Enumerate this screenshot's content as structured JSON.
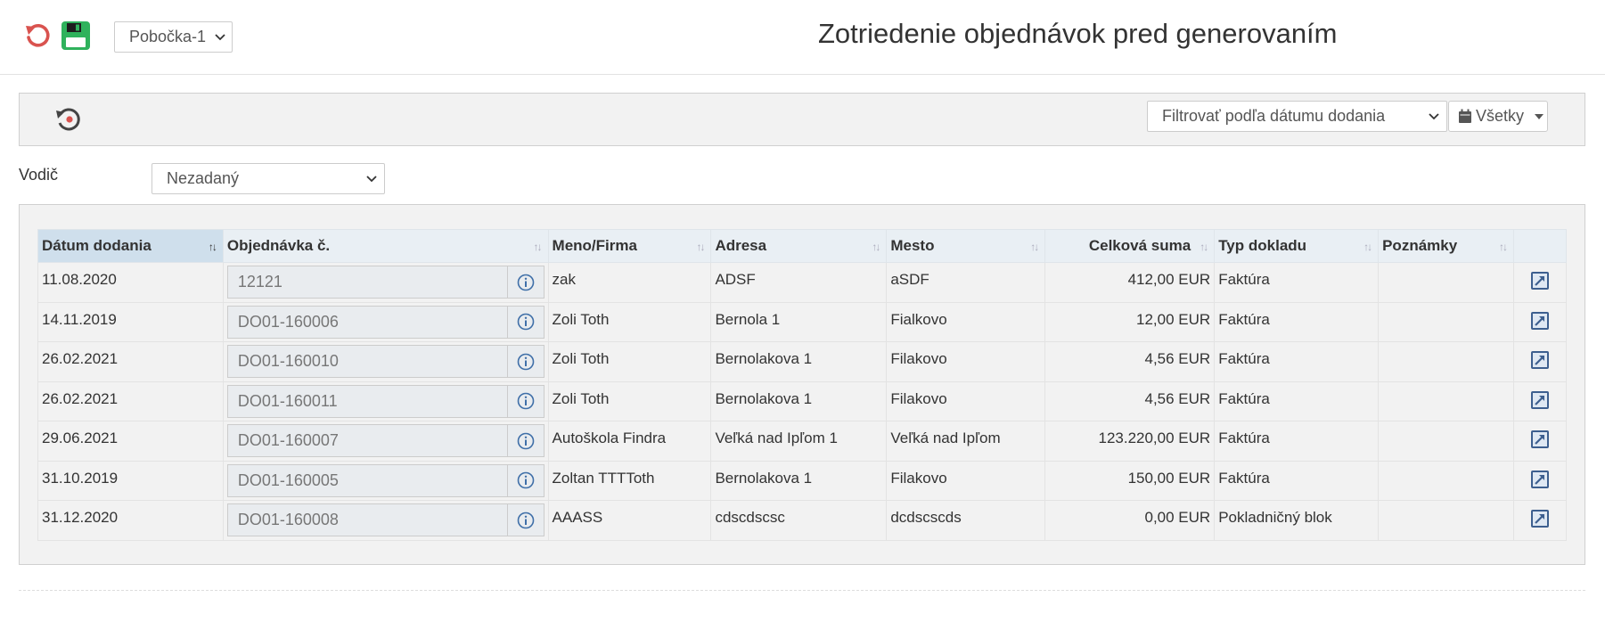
{
  "header": {
    "branch_select": "Pobočka-1",
    "title": "Zotriedenie objednávok pred generovaním"
  },
  "filters": {
    "date_filter_placeholder": "Filtrovať podľa dátumu dodania",
    "all_label": "Všetky",
    "driver_label": "Vodič",
    "driver_value": "Nezadaný"
  },
  "table": {
    "columns": [
      "Dátum dodania",
      "Objednávka č.",
      "Meno/Firma",
      "Adresa",
      "Mesto",
      "Celková suma",
      "Typ dokladu",
      "Poznámky"
    ],
    "rows": [
      {
        "date": "11.08.2020",
        "order": "12121",
        "name": "zak",
        "address": "ADSF",
        "city": "aSDF",
        "total": "412,00 EUR",
        "doc_type": "Faktúra",
        "notes": ""
      },
      {
        "date": "14.11.2019",
        "order": "DO01-160006",
        "name": "Zoli Toth",
        "address": "Bernola 1",
        "city": "Fialkovo",
        "total": "12,00 EUR",
        "doc_type": "Faktúra",
        "notes": ""
      },
      {
        "date": "26.02.2021",
        "order": "DO01-160010",
        "name": "Zoli Toth",
        "address": "Bernolakova 1",
        "city": "Filakovo",
        "total": "4,56 EUR",
        "doc_type": "Faktúra",
        "notes": ""
      },
      {
        "date": "26.02.2021",
        "order": "DO01-160011",
        "name": "Zoli Toth",
        "address": "Bernolakova 1",
        "city": "Filakovo",
        "total": "4,56 EUR",
        "doc_type": "Faktúra",
        "notes": ""
      },
      {
        "date": "29.06.2021",
        "order": "DO01-160007",
        "name": "Autoškola Findra",
        "address": "Veľká nad Ipľom 1",
        "city": "Veľká nad Ipľom",
        "total": "123.220,00 EUR",
        "doc_type": "Faktúra",
        "notes": ""
      },
      {
        "date": "31.10.2019",
        "order": "DO01-160005",
        "name": "Zoltan TTTToth",
        "address": "Bernolakova 1",
        "city": "Filakovo",
        "total": "150,00 EUR",
        "doc_type": "Faktúra",
        "notes": ""
      },
      {
        "date": "31.12.2020",
        "order": "DO01-160008",
        "name": "AAASS",
        "address": "cdscdscsc",
        "city": "dcdscscds",
        "total": "0,00 EUR",
        "doc_type": "Pokladničný blok",
        "notes": ""
      }
    ]
  },
  "icons": {
    "undo": "undo-icon",
    "save": "save-icon",
    "reset_filter": "history-reset-icon",
    "calendar": "calendar-icon",
    "info": "info-icon",
    "open": "open-external-icon"
  },
  "colors": {
    "undo_red": "#d9534f",
    "save_green": "#2fb25c",
    "sorted_header": "#cfdfec",
    "header_bg": "#e9eff4",
    "info_blue": "#3f6fa8"
  }
}
